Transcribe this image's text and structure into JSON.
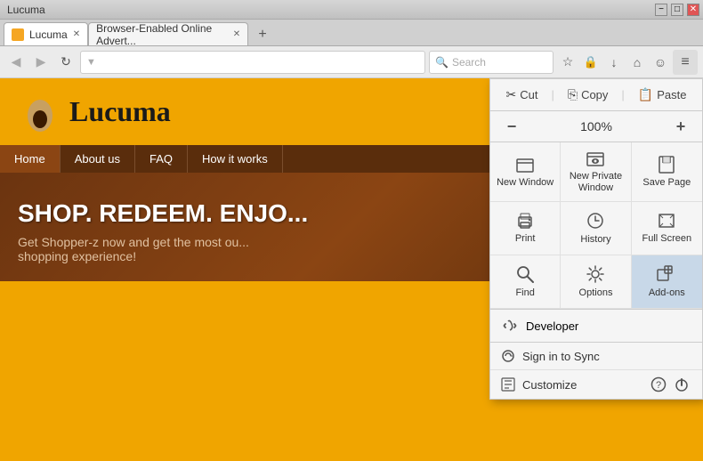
{
  "browser": {
    "title_bar": {
      "title": "Lucuma"
    },
    "title_bar_controls": {
      "minimize": "−",
      "maximize": "□",
      "close": "✕"
    },
    "tabs": [
      {
        "label": "Lucuma",
        "active": true
      },
      {
        "label": "Browser-Enabled Online Advert...",
        "active": false
      }
    ],
    "new_tab_btn": "+",
    "nav": {
      "back_btn": "◀",
      "forward_btn": "▶",
      "refresh_btn": "↻",
      "home_btn": "⌂",
      "address": "",
      "search_placeholder": "Search",
      "bookmark_icon": "☆",
      "download_icon": "↓",
      "home_icon": "⌂",
      "user_icon": "☺",
      "menu_icon": "≡"
    }
  },
  "website": {
    "title": "Lucuma",
    "nav_items": [
      "Home",
      "About us",
      "FAQ",
      "How it works"
    ],
    "hero_title": "SHOP. REDEEM. ENJO...",
    "hero_subtitle": "Get Shopper-z now and get the most ou... shopping experience!"
  },
  "dropdown": {
    "cut_label": "Cut",
    "copy_label": "Copy",
    "paste_label": "Paste",
    "zoom_minus": "−",
    "zoom_percent": "100%",
    "zoom_plus": "+",
    "grid_items": [
      {
        "label": "New Window",
        "icon": "window"
      },
      {
        "label": "New Private Window",
        "icon": "private"
      },
      {
        "label": "Save Page",
        "icon": "save"
      },
      {
        "label": "Print",
        "icon": "print"
      },
      {
        "label": "History",
        "icon": "history"
      },
      {
        "label": "Full Screen",
        "icon": "fullscreen"
      },
      {
        "label": "Find",
        "icon": "find"
      },
      {
        "label": "Options",
        "icon": "options"
      },
      {
        "label": "Add-ons",
        "icon": "addons",
        "highlighted": true
      }
    ],
    "developer_label": "Developer",
    "sign_in_label": "Sign in to Sync",
    "customize_label": "Customize",
    "help_icon": "?",
    "power_icon": "⏻"
  }
}
